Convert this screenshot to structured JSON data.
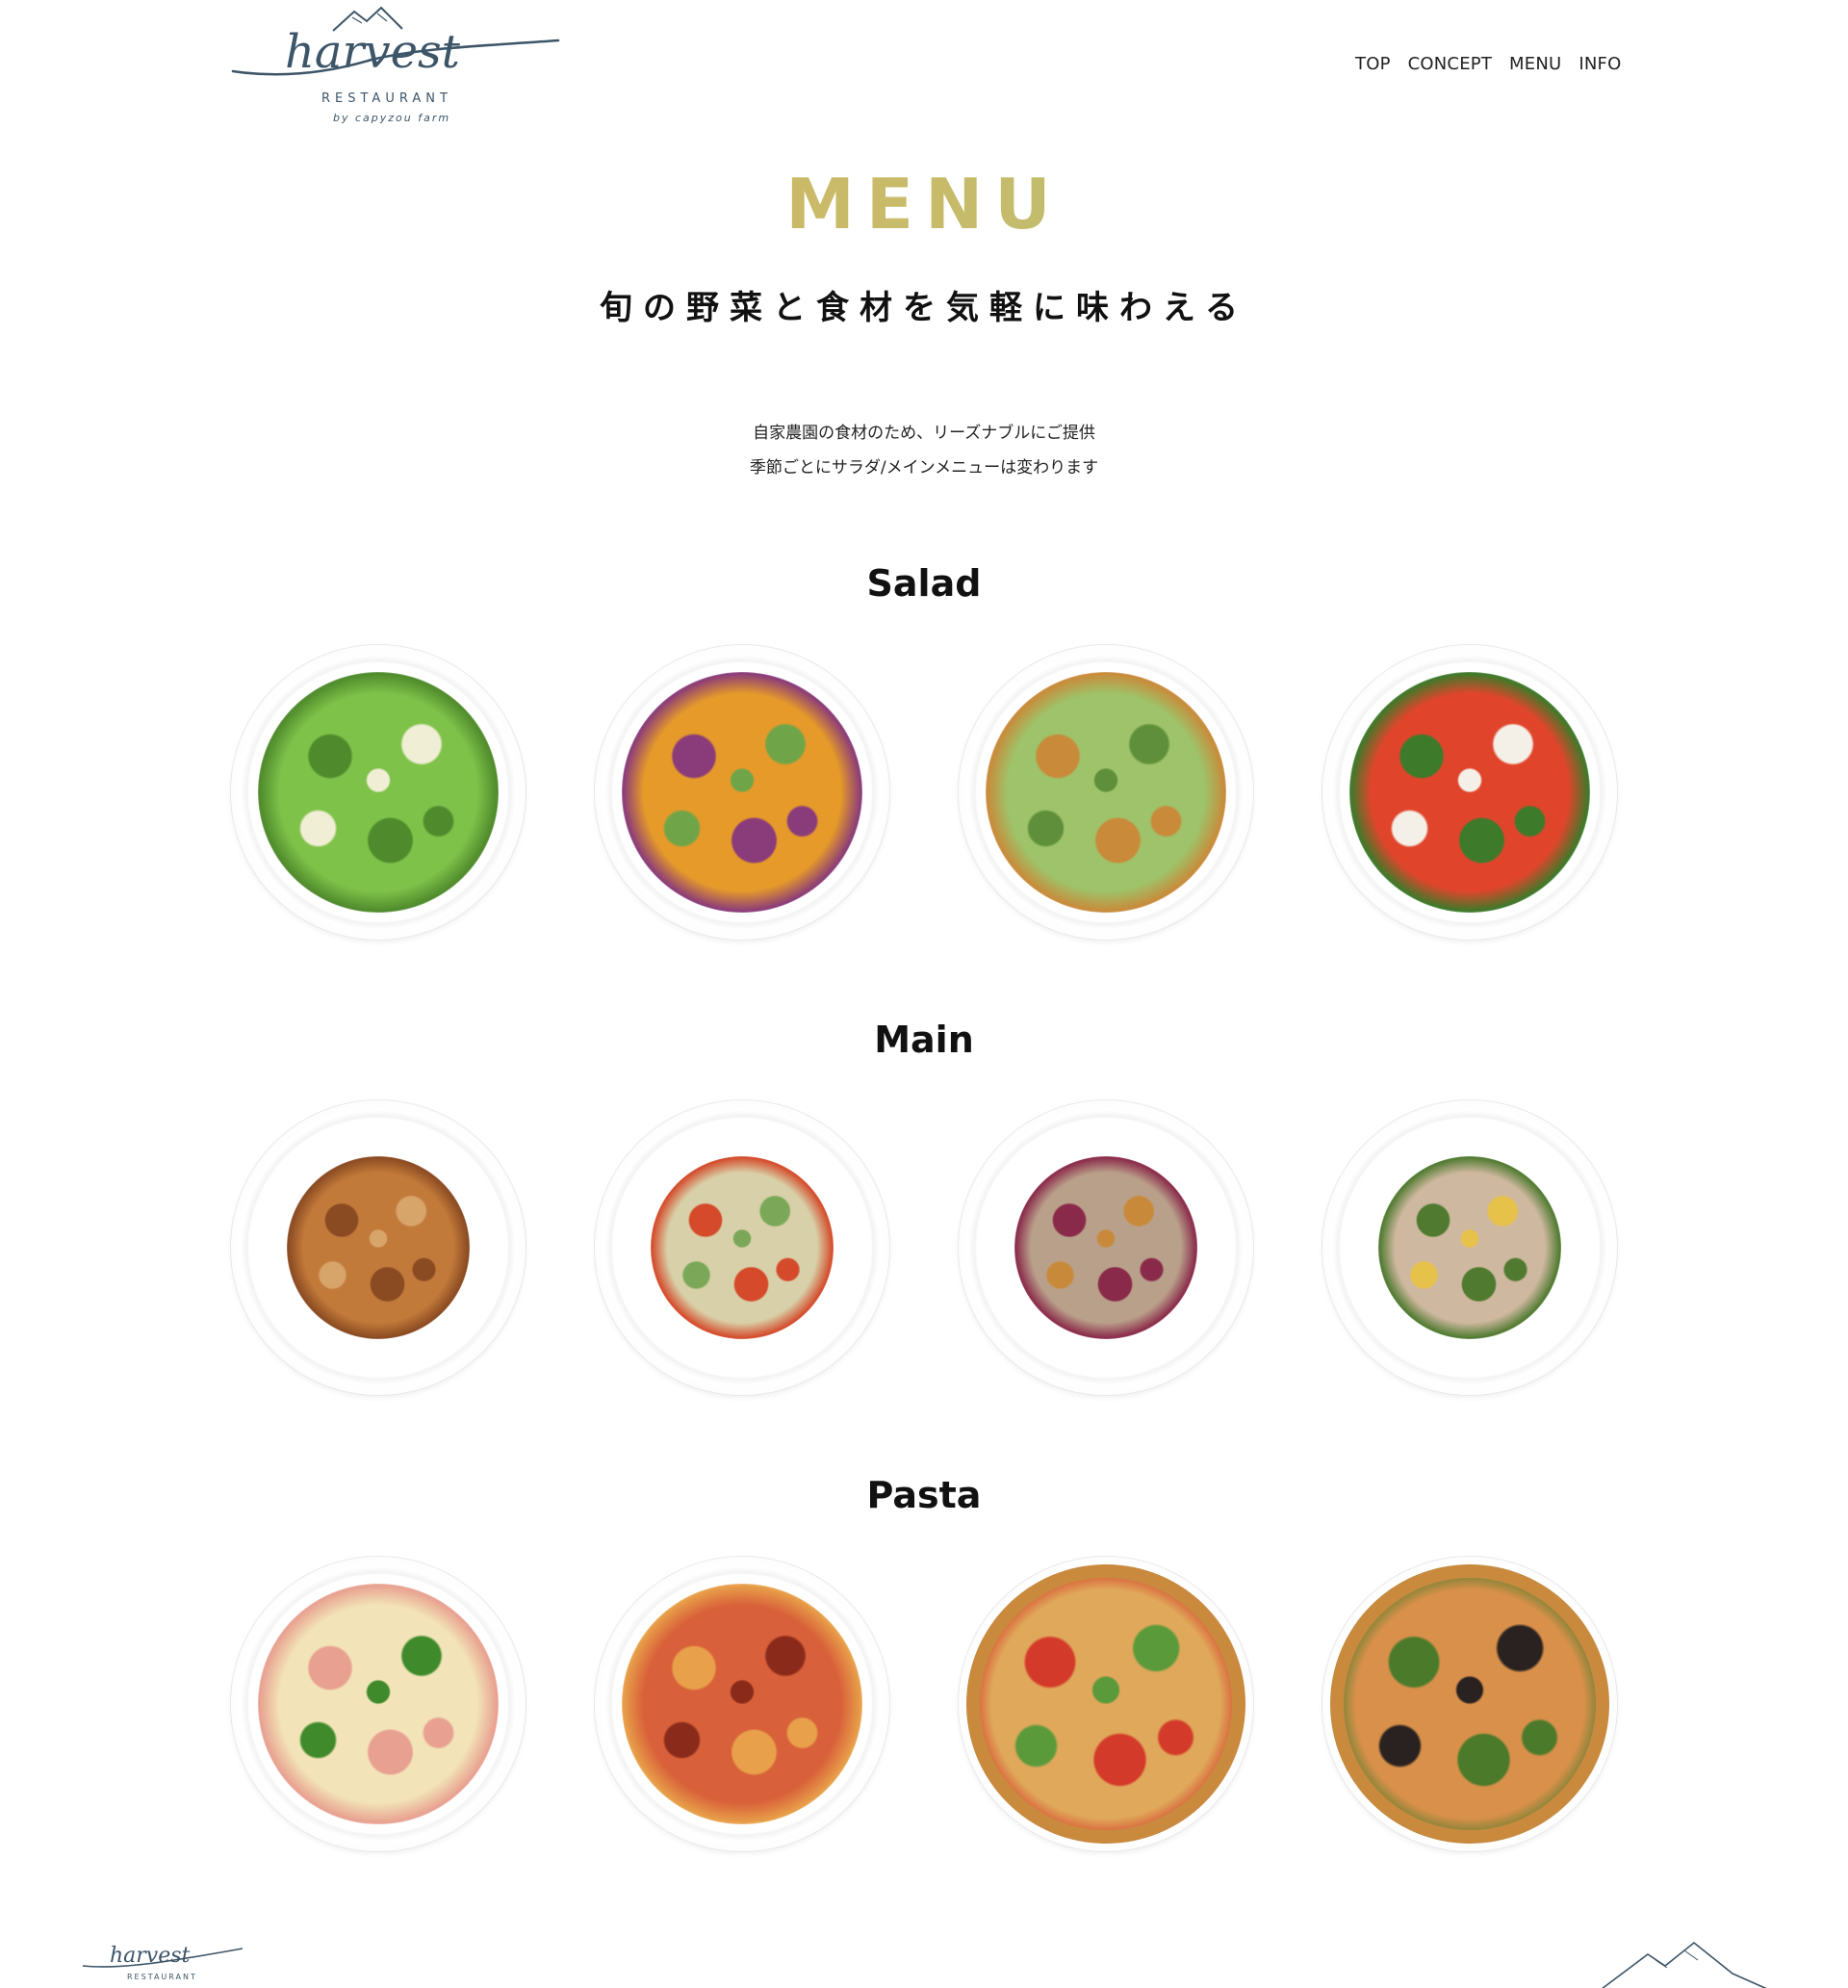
{
  "brand": {
    "logo_wordmark": "harvest",
    "logo_line1": "RESTAURANT",
    "logo_line2": "by capyzou farm",
    "logo_color": "#3d5568"
  },
  "nav": {
    "items": [
      {
        "label": "TOP"
      },
      {
        "label": "CONCEPT"
      },
      {
        "label": "MENU"
      },
      {
        "label": "INFO"
      }
    ]
  },
  "hero": {
    "title": "MENU",
    "title_gradient": [
      "#d6b45e",
      "#9dc27b"
    ],
    "subtitle": "旬の野菜と食材を気軽に味わえる",
    "intro_line1": "自家農園の食材のため、リーズナブルにご提供",
    "intro_line2": "季節ごとにサラダ/メインメニューは変わります"
  },
  "sections": [
    {
      "title": "Salad",
      "dishes": [
        {
          "photo": "asparagus-parmesan-salad",
          "colors": [
            "#7fc24a",
            "#4f8a2c",
            "#f1eed6"
          ]
        },
        {
          "photo": "pumpkin-purple-cabbage-salad",
          "colors": [
            "#e59a2a",
            "#8a3b7a",
            "#6fa548"
          ]
        },
        {
          "photo": "avocado-tofu-salad",
          "colors": [
            "#9ec36a",
            "#c98a3a",
            "#5f8f3a"
          ]
        },
        {
          "photo": "tomato-feta-salad",
          "colors": [
            "#e0452c",
            "#3d7a2a",
            "#f4f0e8"
          ]
        }
      ]
    },
    {
      "title": "Main",
      "dishes": [
        {
          "photo": "glazed-chicken-plate",
          "colors": [
            "#c27a3a",
            "#8a4a22",
            "#d7a46a"
          ]
        },
        {
          "photo": "shrimp-risotto-plate",
          "colors": [
            "#d8d0a8",
            "#d44a2a",
            "#7aa858"
          ]
        },
        {
          "photo": "fish-with-beet-plate",
          "colors": [
            "#b9a08a",
            "#8a2a4a",
            "#c88a3a"
          ]
        },
        {
          "photo": "tuna-green-bean-plate",
          "colors": [
            "#cfb8a0",
            "#4f7a30",
            "#e6c24a"
          ]
        }
      ]
    },
    {
      "title": "Pasta",
      "dishes": [
        {
          "photo": "carbonara-fettuccine",
          "colors": [
            "#f2e4b8",
            "#e8a090",
            "#3f8a2a"
          ]
        },
        {
          "photo": "tomato-tagliatelle",
          "colors": [
            "#d8603a",
            "#e8a04a",
            "#8a2a1a"
          ]
        },
        {
          "photo": "vegetable-pizza",
          "colors": [
            "#e0a85a",
            "#d43a2a",
            "#5a9a3a"
          ]
        },
        {
          "photo": "rucola-anchovy-pizza",
          "colors": [
            "#d8904a",
            "#4a7a2a",
            "#2a2220"
          ]
        }
      ]
    }
  ]
}
